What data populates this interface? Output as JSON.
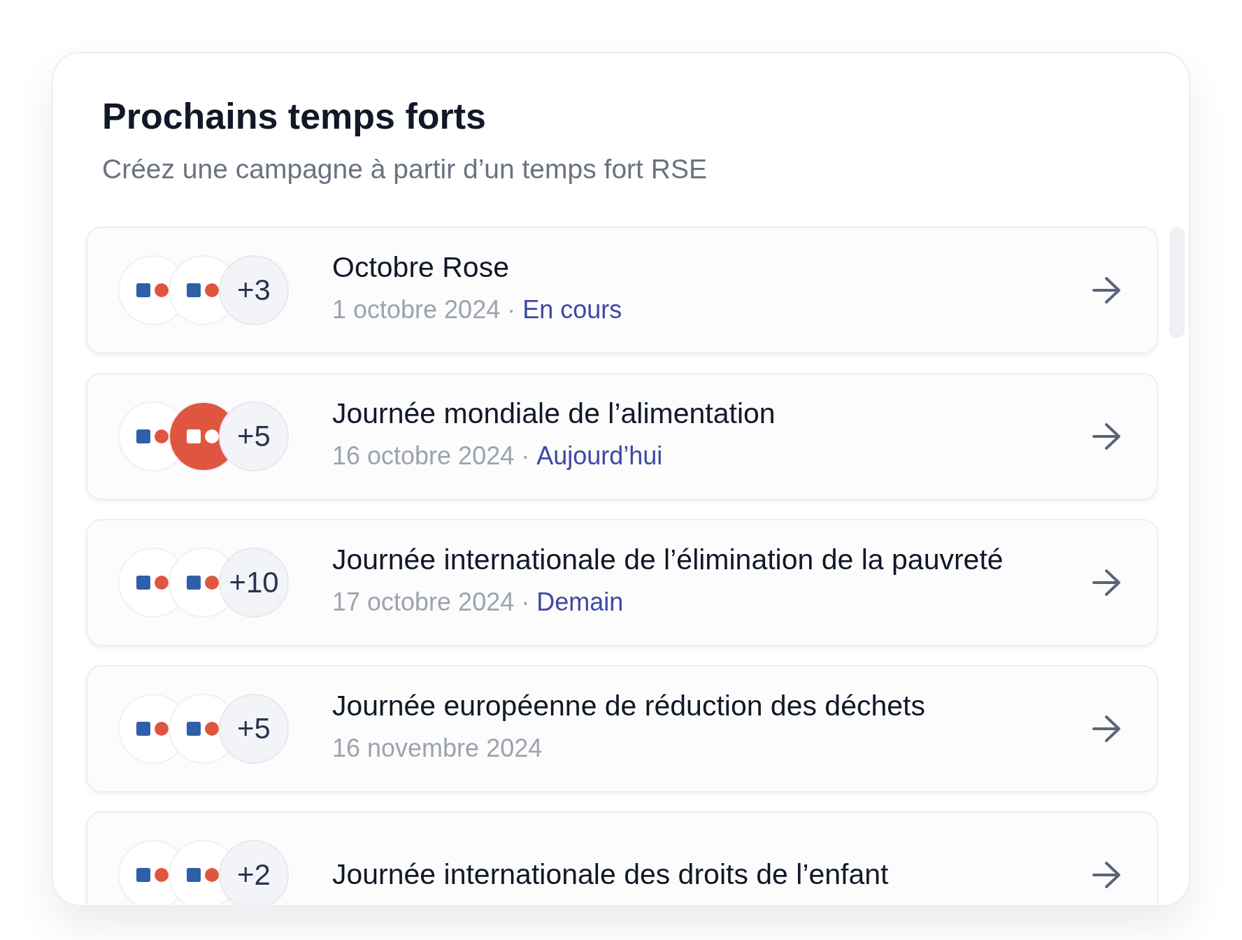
{
  "title": "Prochains temps forts",
  "subtitle": "Créez une campagne à partir d’un temps fort RSE",
  "events": [
    {
      "title": "Octobre Rose",
      "date": "1 octobre 2024",
      "separator": "·",
      "status": "En cours",
      "more": "+3",
      "logos": [
        {
          "color": "#ffffff"
        },
        {
          "color": "#ffffff"
        }
      ]
    },
    {
      "title": "Journée mondiale de l’alimentation",
      "date": "16 octobre 2024",
      "separator": "·",
      "status": "Aujourd’hui",
      "more": "+5",
      "logos": [
        {
          "color": "#ffffff"
        },
        {
          "color": "#e0553f"
        }
      ]
    },
    {
      "title": "Journée internationale de l’élimination de la pauvreté",
      "date": "17 octobre 2024",
      "separator": "·",
      "status": "Demain",
      "more": "+10",
      "logos": [
        {
          "color": "#ffffff"
        },
        {
          "color": "#ffffff"
        }
      ]
    },
    {
      "title": "Journée européenne de réduction des déchets",
      "date": "16 novembre 2024",
      "more": "+5",
      "logos": [
        {
          "color": "#ffffff"
        },
        {
          "color": "#ffffff"
        }
      ]
    },
    {
      "title": "Journée internationale des droits de l’enfant",
      "more": "+2",
      "logos": [
        {
          "color": "#ffffff"
        },
        {
          "color": "#ffffff"
        }
      ]
    }
  ]
}
